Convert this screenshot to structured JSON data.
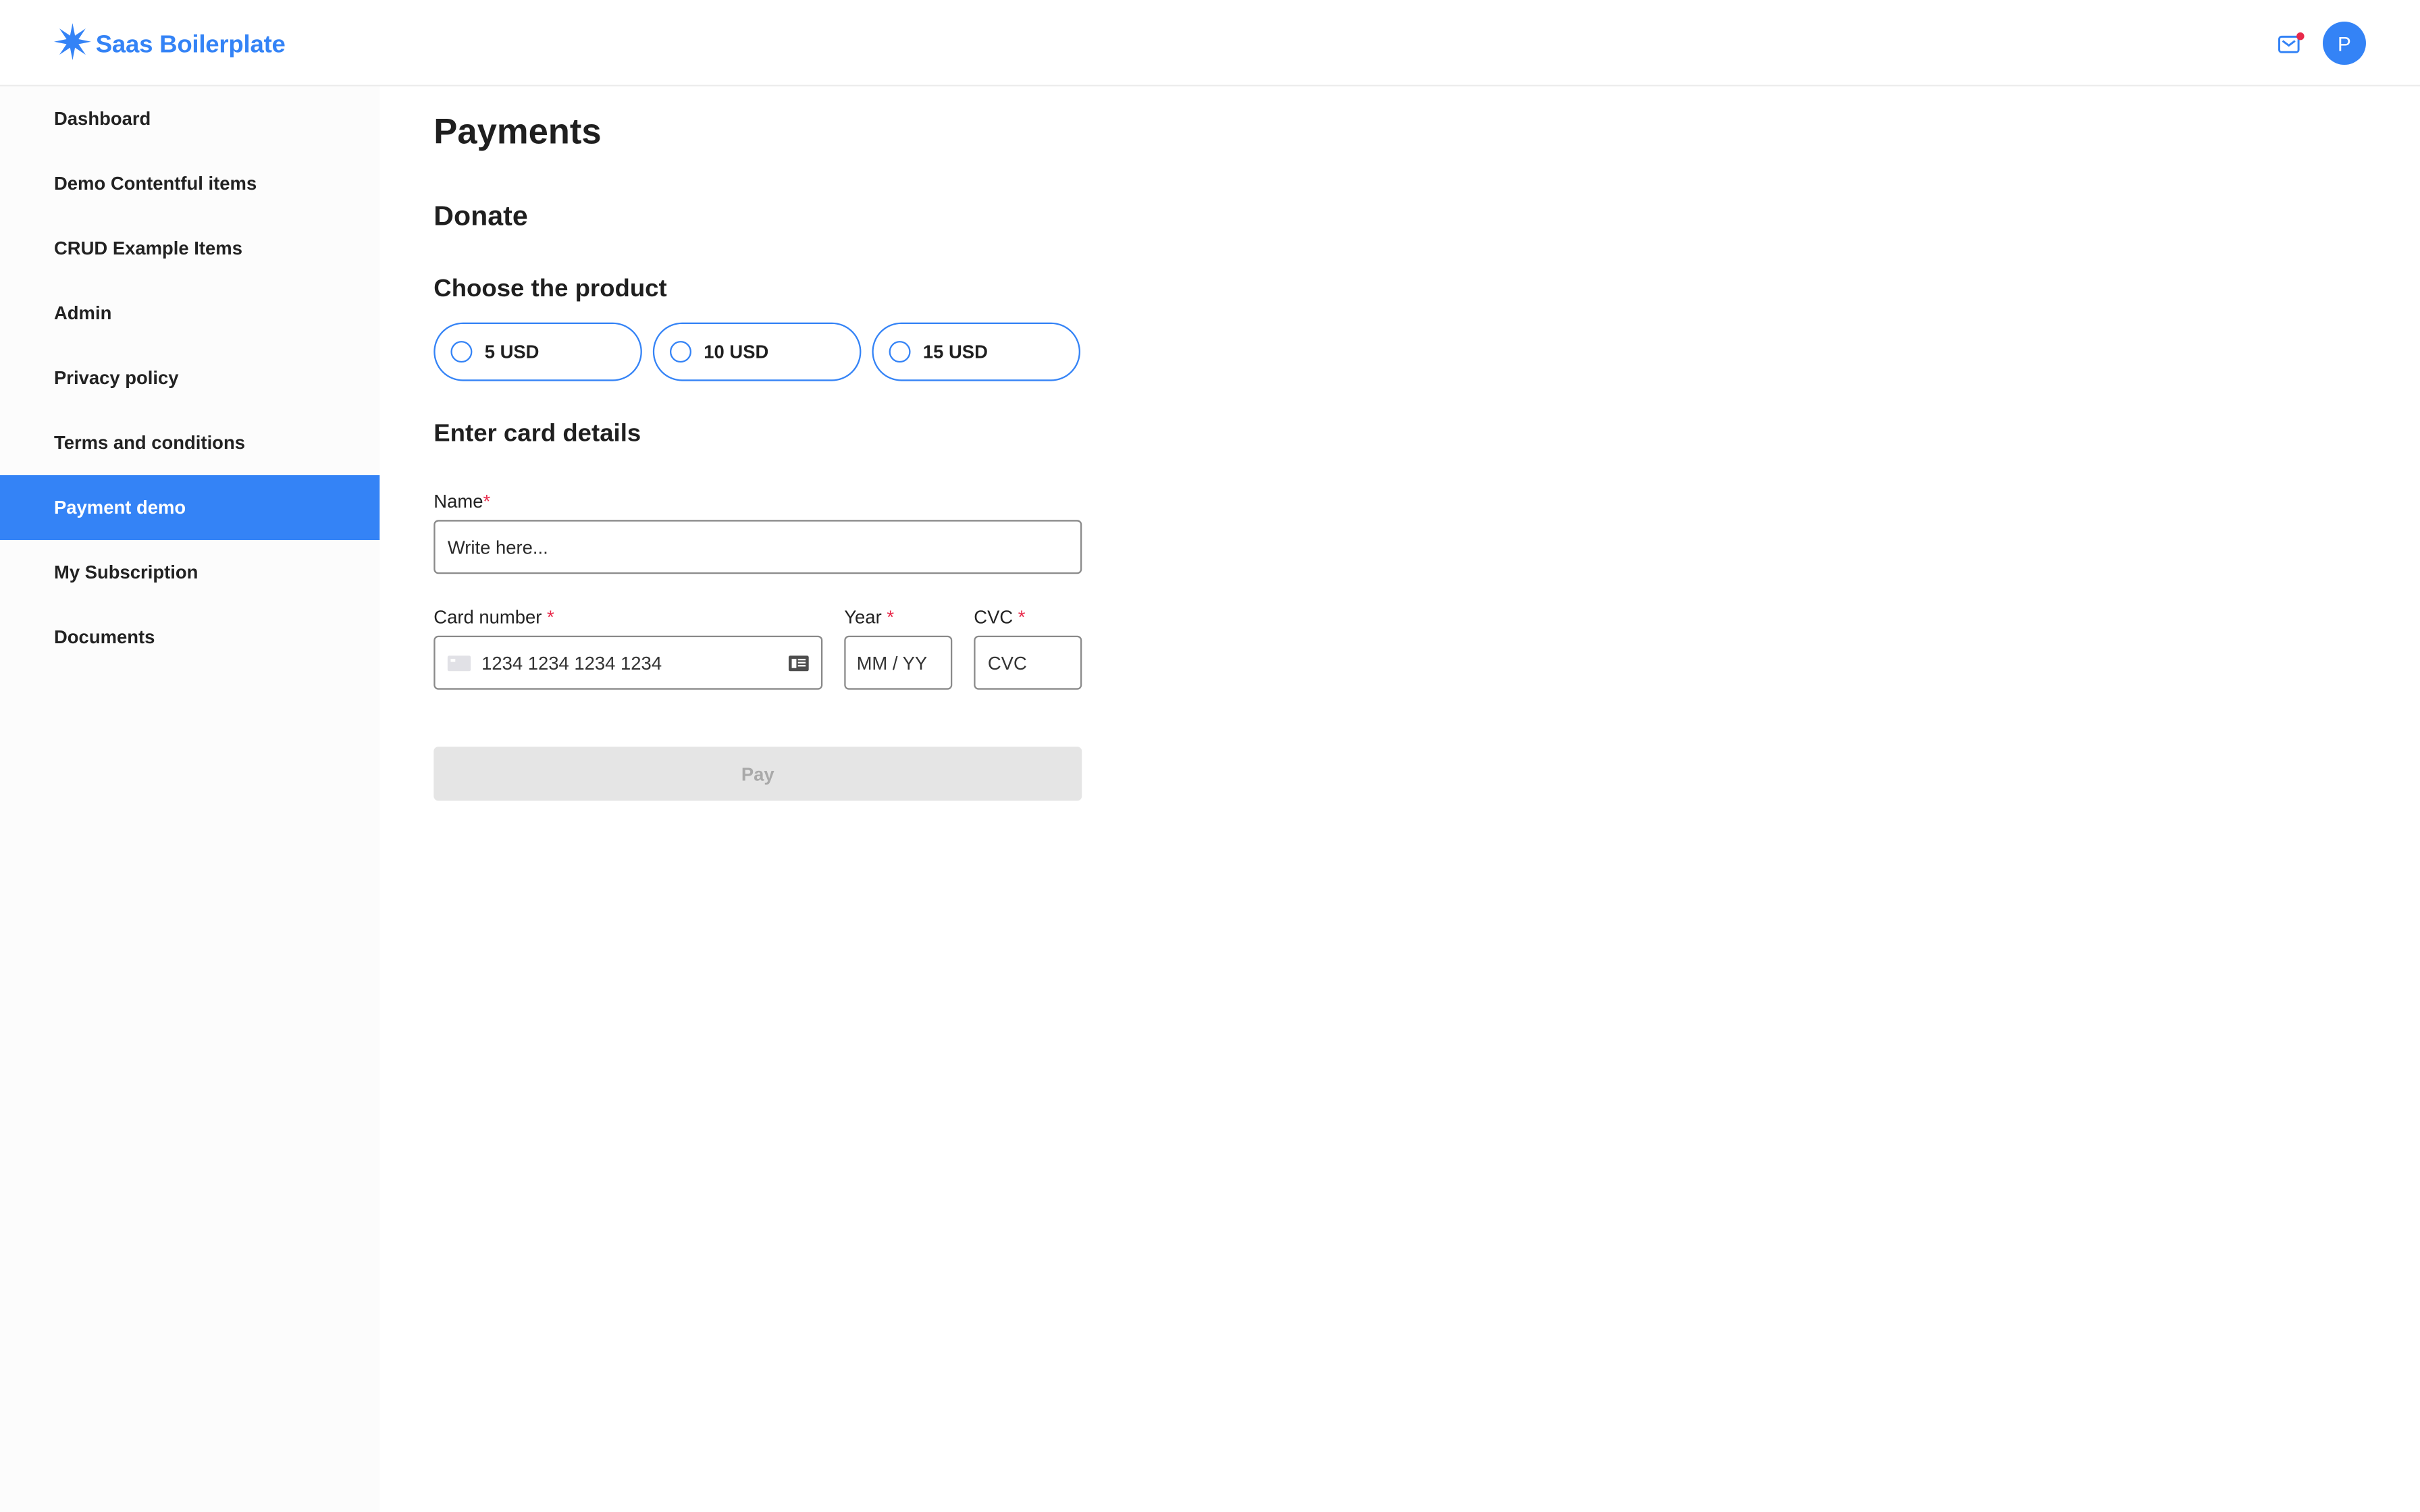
{
  "app": {
    "name": "Saas Boilerplate",
    "brand_color": "#3483F6",
    "logo_icon": "star-burst-icon"
  },
  "header": {
    "mail_icon": "mail-icon",
    "notification_dot_color": "#E8294A",
    "avatar_initial": "P"
  },
  "sidebar": {
    "items": [
      {
        "label": "Dashboard",
        "active": false
      },
      {
        "label": "Demo Contentful items",
        "active": false
      },
      {
        "label": "CRUD Example Items",
        "active": false
      },
      {
        "label": "Admin",
        "active": false
      },
      {
        "label": "Privacy policy",
        "active": false
      },
      {
        "label": "Terms and conditions",
        "active": false
      },
      {
        "label": "Payment demo",
        "active": true
      },
      {
        "label": "My Subscription",
        "active": false
      },
      {
        "label": "Documents",
        "active": false
      }
    ]
  },
  "main": {
    "title": "Payments",
    "section_title": "Donate",
    "product_heading": "Choose the product",
    "products": [
      {
        "label": "5 USD",
        "selected": false
      },
      {
        "label": "10 USD",
        "selected": false
      },
      {
        "label": "15 USD",
        "selected": false
      }
    ],
    "card_heading": "Enter card details",
    "required_marker": "*",
    "name_field": {
      "label": "Name",
      "placeholder": "Write here...",
      "value": ""
    },
    "card_number_field": {
      "label": "Card number ",
      "placeholder": "1234 1234 1234 1234"
    },
    "year_field": {
      "label": "Year ",
      "placeholder": "MM / YY"
    },
    "cvc_field": {
      "label": "CVC ",
      "placeholder": "CVC"
    },
    "pay_button": {
      "label": "Pay",
      "disabled": true
    }
  }
}
